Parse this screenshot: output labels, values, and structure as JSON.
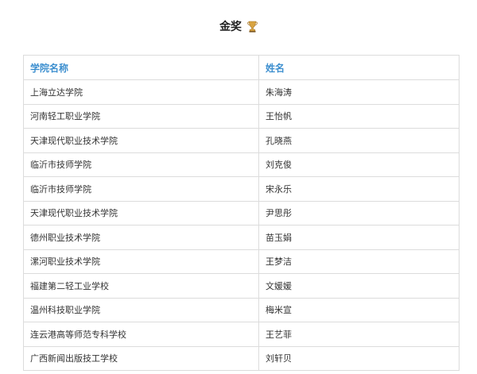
{
  "header": {
    "title": "金奖",
    "icon": "trophy-icon"
  },
  "table": {
    "columns": [
      "学院名称",
      "姓名"
    ],
    "rows": [
      [
        "上海立达学院",
        "朱海涛"
      ],
      [
        "河南轻工职业学院",
        "王怡帆"
      ],
      [
        "天津现代职业技术学院",
        "孔晓燕"
      ],
      [
        "临沂市技师学院",
        "刘克俊"
      ],
      [
        "临沂市技师学院",
        "宋永乐"
      ],
      [
        "天津现代职业技术学院",
        "尹思彤"
      ],
      [
        "德州职业技术学院",
        "苗玉娟"
      ],
      [
        "漯河职业技术学院",
        "王梦洁"
      ],
      [
        "福建第二轻工业学校",
        "文媛媛"
      ],
      [
        "温州科技职业学院",
        "梅米宣"
      ],
      [
        "连云港高等师范专科学校",
        "王艺菲"
      ],
      [
        "广西新闻出版技工学校",
        "刘轩贝"
      ]
    ]
  },
  "colors": {
    "header_text": "#3d8fcf",
    "border": "#dcdcdc"
  }
}
